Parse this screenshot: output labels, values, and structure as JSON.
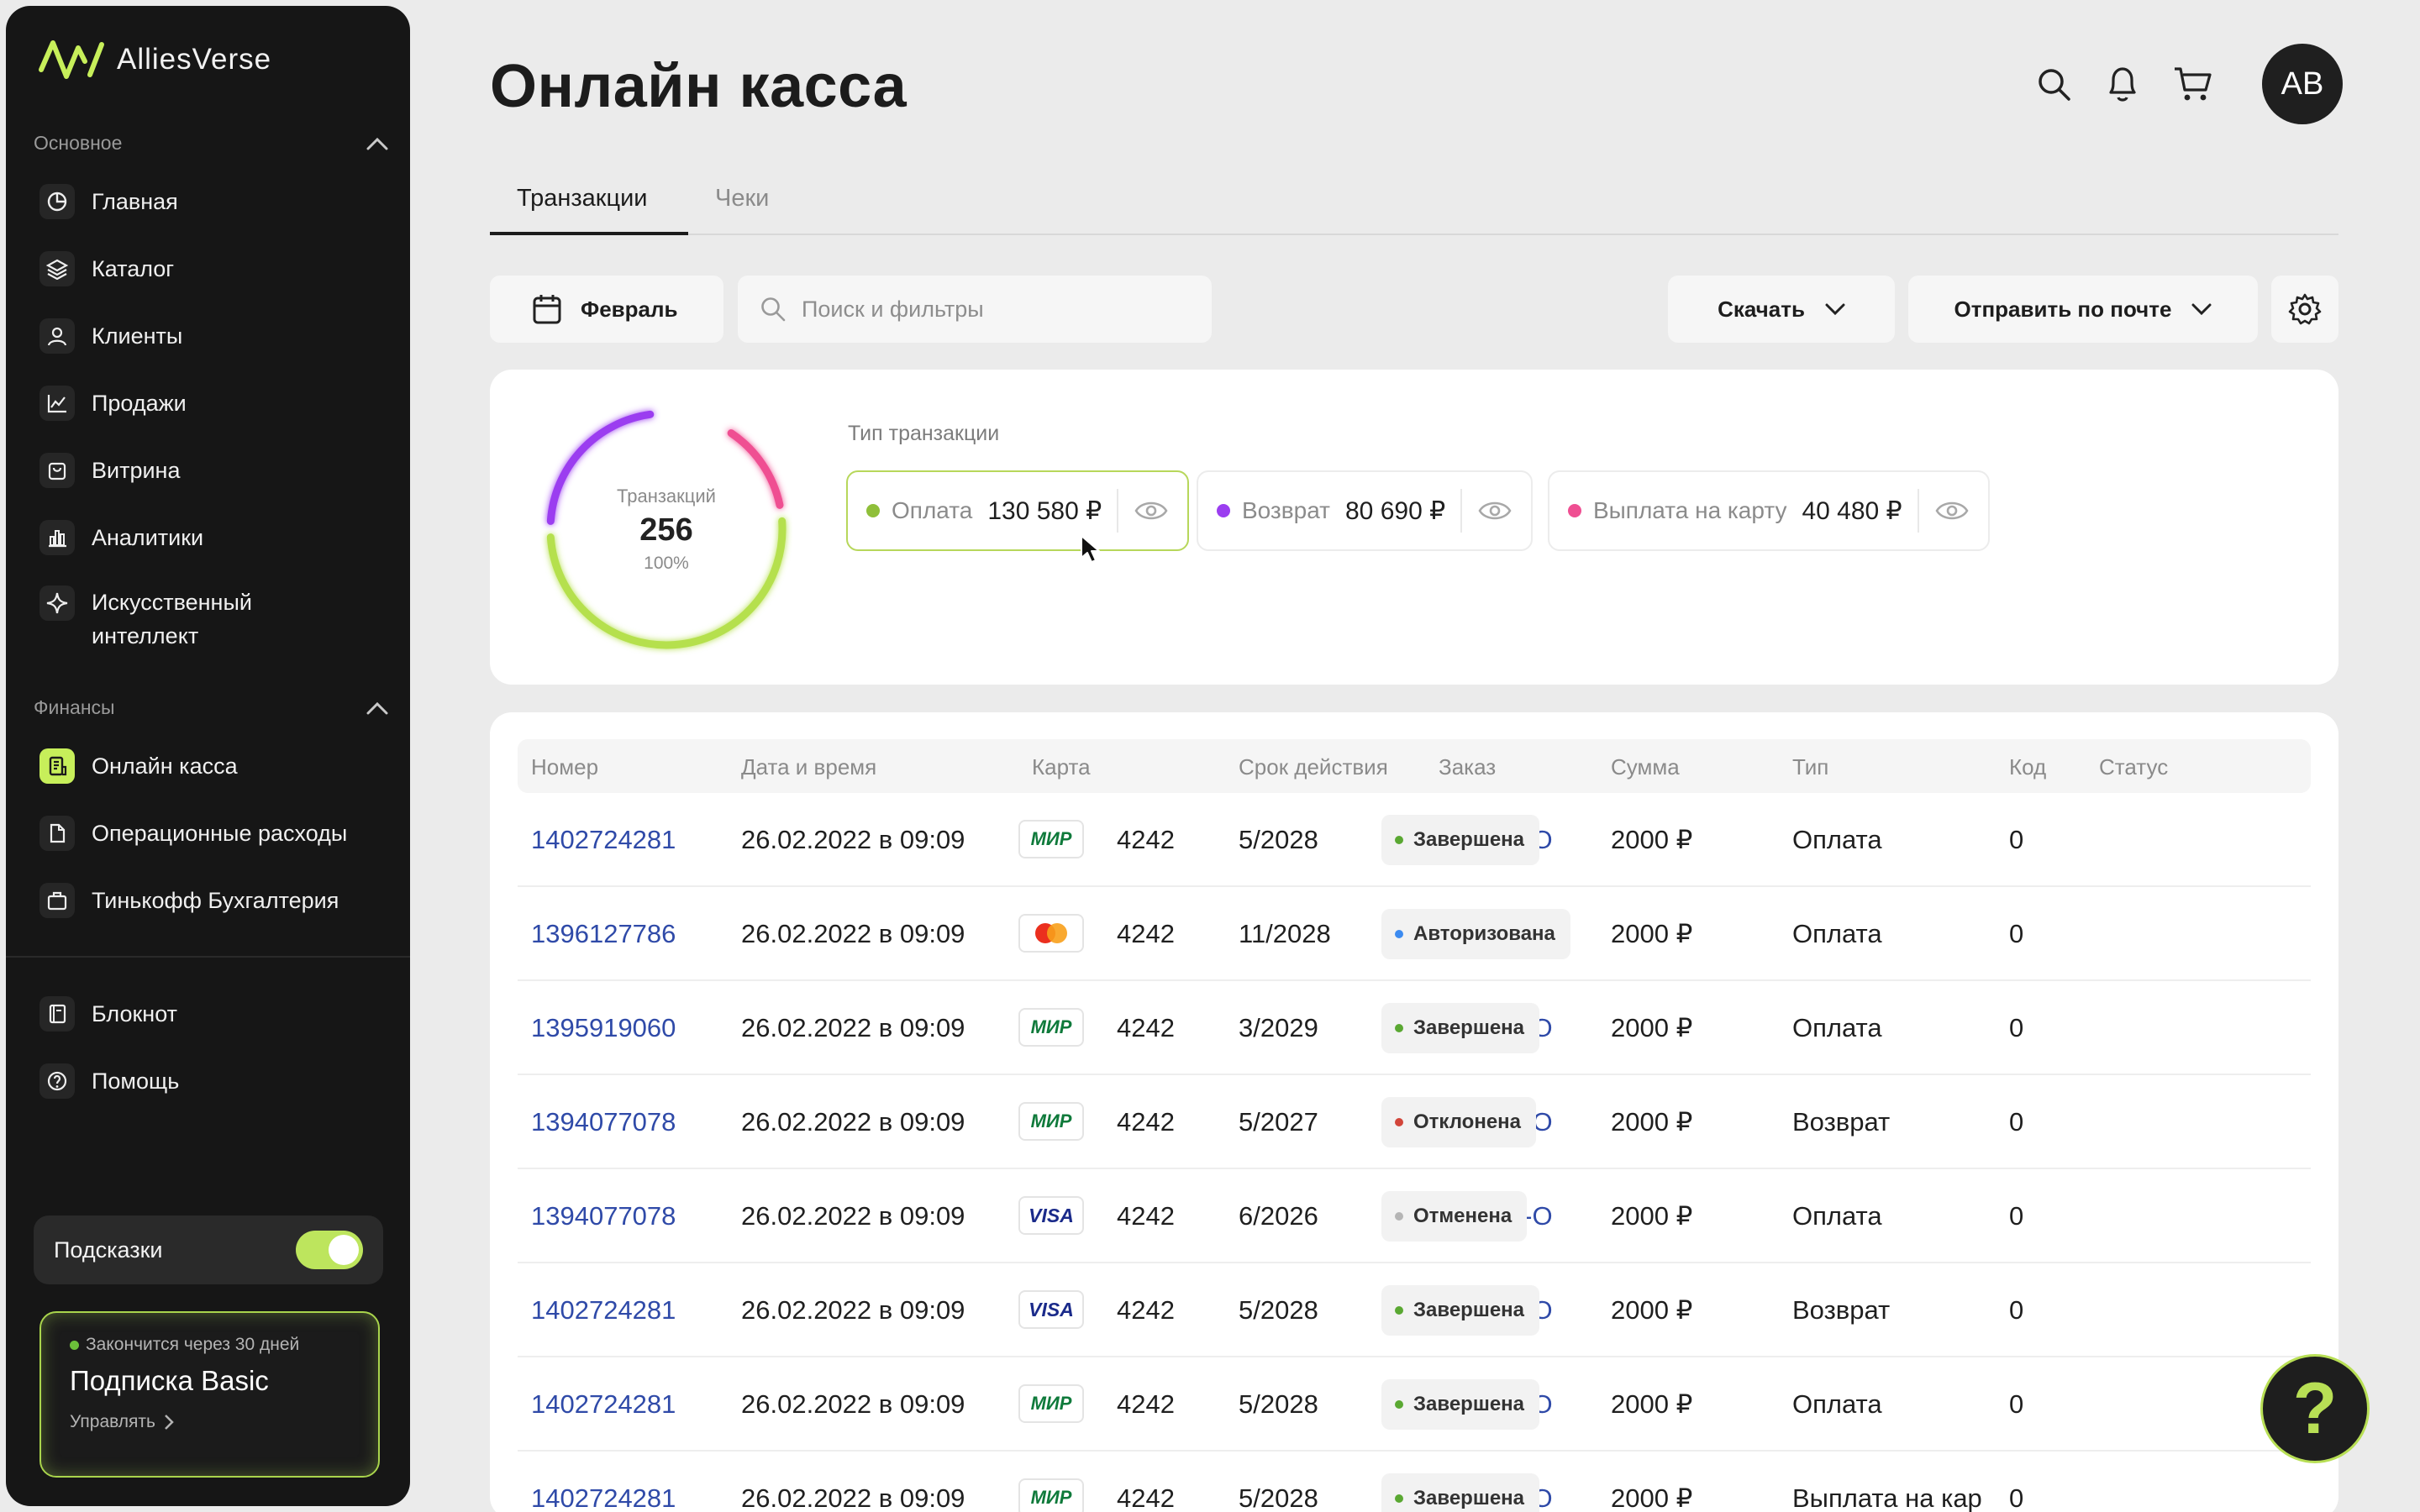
{
  "brand": {
    "name": "AlliesVerse"
  },
  "sidebar": {
    "section_main": "Основное",
    "main_items": [
      {
        "label": "Главная",
        "icon": "pie-chart-icon"
      },
      {
        "label": "Каталог",
        "icon": "layers-icon"
      },
      {
        "label": "Клиенты",
        "icon": "user-icon"
      },
      {
        "label": "Продажи",
        "icon": "line-chart-icon"
      },
      {
        "label": "Витрина",
        "icon": "shopping-bag-icon"
      },
      {
        "label": "Аналитики",
        "icon": "bar-chart-icon"
      },
      {
        "label": "Искусственный интеллект",
        "icon": "sparkle-icon"
      }
    ],
    "section_finance": "Финансы",
    "finance_items": [
      {
        "label": "Онлайн касса",
        "icon": "cash-register-icon",
        "active": true
      },
      {
        "label": "Операционные расходы",
        "icon": "document-icon"
      },
      {
        "label": "Тинькофф Бухгалтерия",
        "icon": "briefcase-icon"
      }
    ],
    "extra_items": [
      {
        "label": "Блокнот",
        "icon": "notebook-icon"
      },
      {
        "label": "Помощь",
        "icon": "question-circle-icon"
      }
    ],
    "hints_label": "Подсказки",
    "hints_enabled": true,
    "subscription": {
      "note": "Закончится через 30 дней",
      "title": "Подписка Basic",
      "manage": "Управлять"
    }
  },
  "header": {
    "title": "Онлайн касса",
    "avatar_initials": "AB"
  },
  "tabs": [
    {
      "label": "Транзакции",
      "active": true
    },
    {
      "label": "Чеки",
      "active": false
    }
  ],
  "toolbar": {
    "month": "Февраль",
    "search_placeholder": "Поиск и фильтры",
    "download": "Скачать",
    "send_mail": "Отправить по почте"
  },
  "summary": {
    "donut_label": "Транзакций",
    "donut_value": "256",
    "donut_percent": "100%",
    "type_title": "Тип транзакции",
    "types": [
      {
        "label": "Оплата",
        "value": "130 580 ₽",
        "color": "#8fbf3a",
        "selected": true
      },
      {
        "label": "Возврат",
        "value": "80 690 ₽",
        "color": "#9b3ef0",
        "selected": false
      },
      {
        "label": "Выплата на карту",
        "value": "40 480 ₽",
        "color": "#ef4f92",
        "selected": false
      }
    ]
  },
  "table": {
    "columns": [
      "Номер",
      "Дата и время",
      "Карта",
      "Срок действия",
      "Заказ",
      "Сумма",
      "Тип",
      "Код",
      "Статус"
    ],
    "rows": [
      {
        "number": "1402724281",
        "datetime": "26.02.2022 в 09:09",
        "card_brand": "mir",
        "card": "4242",
        "expiry": "5/2028",
        "order": "711264-O",
        "amount": "2000 ₽",
        "type": "Оплата",
        "code": "0",
        "status": "Завершена",
        "status_color": "#5aa832"
      },
      {
        "number": "1396127786",
        "datetime": "26.02.2022 в 09:09",
        "card_brand": "mastercard",
        "card": "4242",
        "expiry": "11/2028",
        "order": "711264-O",
        "amount": "2000 ₽",
        "type": "Оплата",
        "code": "0",
        "status": "Авторизована",
        "status_color": "#3c8bf0"
      },
      {
        "number": "1395919060",
        "datetime": "26.02.2022 в 09:09",
        "card_brand": "mir",
        "card": "4242",
        "expiry": "3/2029",
        "order": "711264-O",
        "amount": "2000 ₽",
        "type": "Оплата",
        "code": "0",
        "status": "Завершена",
        "status_color": "#5aa832"
      },
      {
        "number": "1394077078",
        "datetime": "26.02.2022 в 09:09",
        "card_brand": "mir",
        "card": "4242",
        "expiry": "5/2027",
        "order": "711264-O",
        "amount": "2000 ₽",
        "type": "Возврат",
        "code": "0",
        "status": "Отклонена",
        "status_color": "#d2453a"
      },
      {
        "number": "1394077078",
        "datetime": "26.02.2022 в 09:09",
        "card_brand": "visa",
        "card": "4242",
        "expiry": "6/2026",
        "order": "711264-O",
        "amount": "2000 ₽",
        "type": "Оплата",
        "code": "0",
        "status": "Отменена",
        "status_color": "#b5b5b5"
      },
      {
        "number": "1402724281",
        "datetime": "26.02.2022 в 09:09",
        "card_brand": "visa",
        "card": "4242",
        "expiry": "5/2028",
        "order": "711264-O",
        "amount": "2000 ₽",
        "type": "Возврат",
        "code": "0",
        "status": "Завершена",
        "status_color": "#5aa832"
      },
      {
        "number": "1402724281",
        "datetime": "26.02.2022 в 09:09",
        "card_brand": "mir",
        "card": "4242",
        "expiry": "5/2028",
        "order": "711264-O",
        "amount": "2000 ₽",
        "type": "Оплата",
        "code": "0",
        "status": "Завершена",
        "status_color": "#5aa832"
      },
      {
        "number": "1402724281",
        "datetime": "26.02.2022 в 09:09",
        "card_brand": "mir",
        "card": "4242",
        "expiry": "5/2028",
        "order": "711264-O",
        "amount": "2000 ₽",
        "type": "Выплата на кар",
        "code": "0",
        "status": "Завершена",
        "status_color": "#5aa832"
      }
    ]
  },
  "help_button": "?"
}
